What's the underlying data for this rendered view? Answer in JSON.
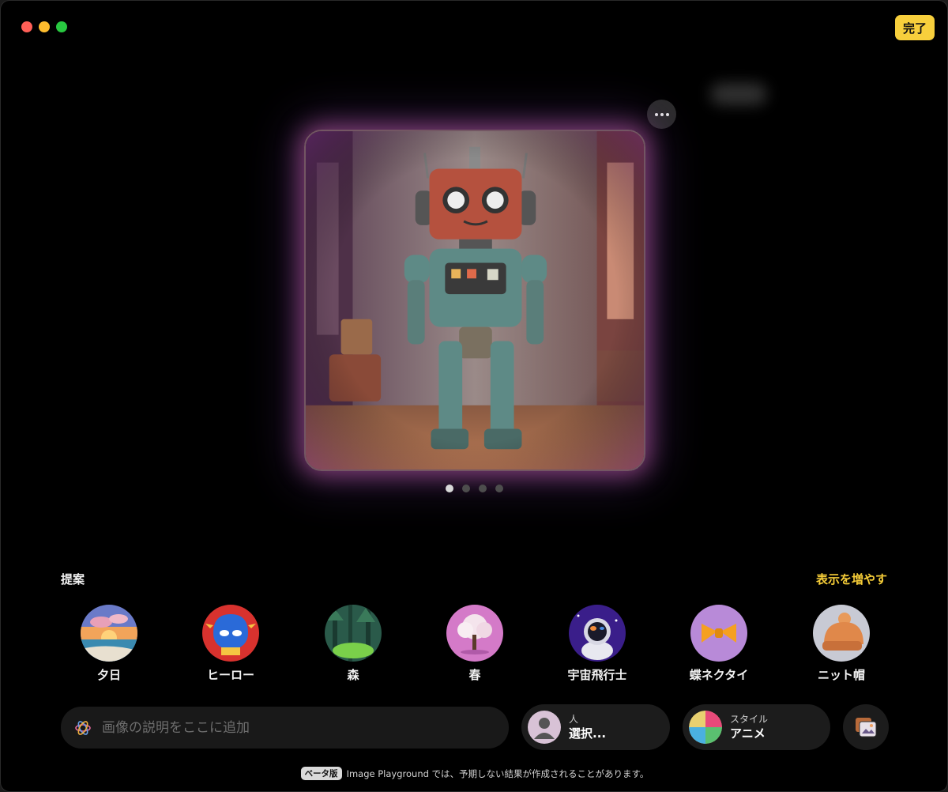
{
  "window": {
    "done_label": "完了"
  },
  "preview": {
    "page_count": 4,
    "active_page": 1
  },
  "suggestions": {
    "title": "提案",
    "show_more_label": "表示を増やす",
    "items": [
      {
        "label": "夕日",
        "icon": "sunset-thumbnail"
      },
      {
        "label": "ヒーロー",
        "icon": "hero-mask-thumbnail"
      },
      {
        "label": "森",
        "icon": "forest-thumbnail"
      },
      {
        "label": "春",
        "icon": "spring-tree-thumbnail"
      },
      {
        "label": "宇宙飛行士",
        "icon": "astronaut-thumbnail"
      },
      {
        "label": "蝶ネクタイ",
        "icon": "bow-tie-thumbnail"
      },
      {
        "label": "ニット帽",
        "icon": "knit-hat-thumbnail"
      }
    ]
  },
  "prompt": {
    "placeholder": "画像の説明をここに追加"
  },
  "person_picker": {
    "sub_label": "人",
    "value": "選択..."
  },
  "style_picker": {
    "sub_label": "スタイル",
    "value": "アニメ"
  },
  "footer": {
    "beta_badge": "ベータ版",
    "disclaimer": "Image Playground では、予期しない結果が作成されることがあります。"
  },
  "colors": {
    "accent": "#f7cf3c",
    "background": "#000000",
    "glow": "#cc60b0"
  }
}
